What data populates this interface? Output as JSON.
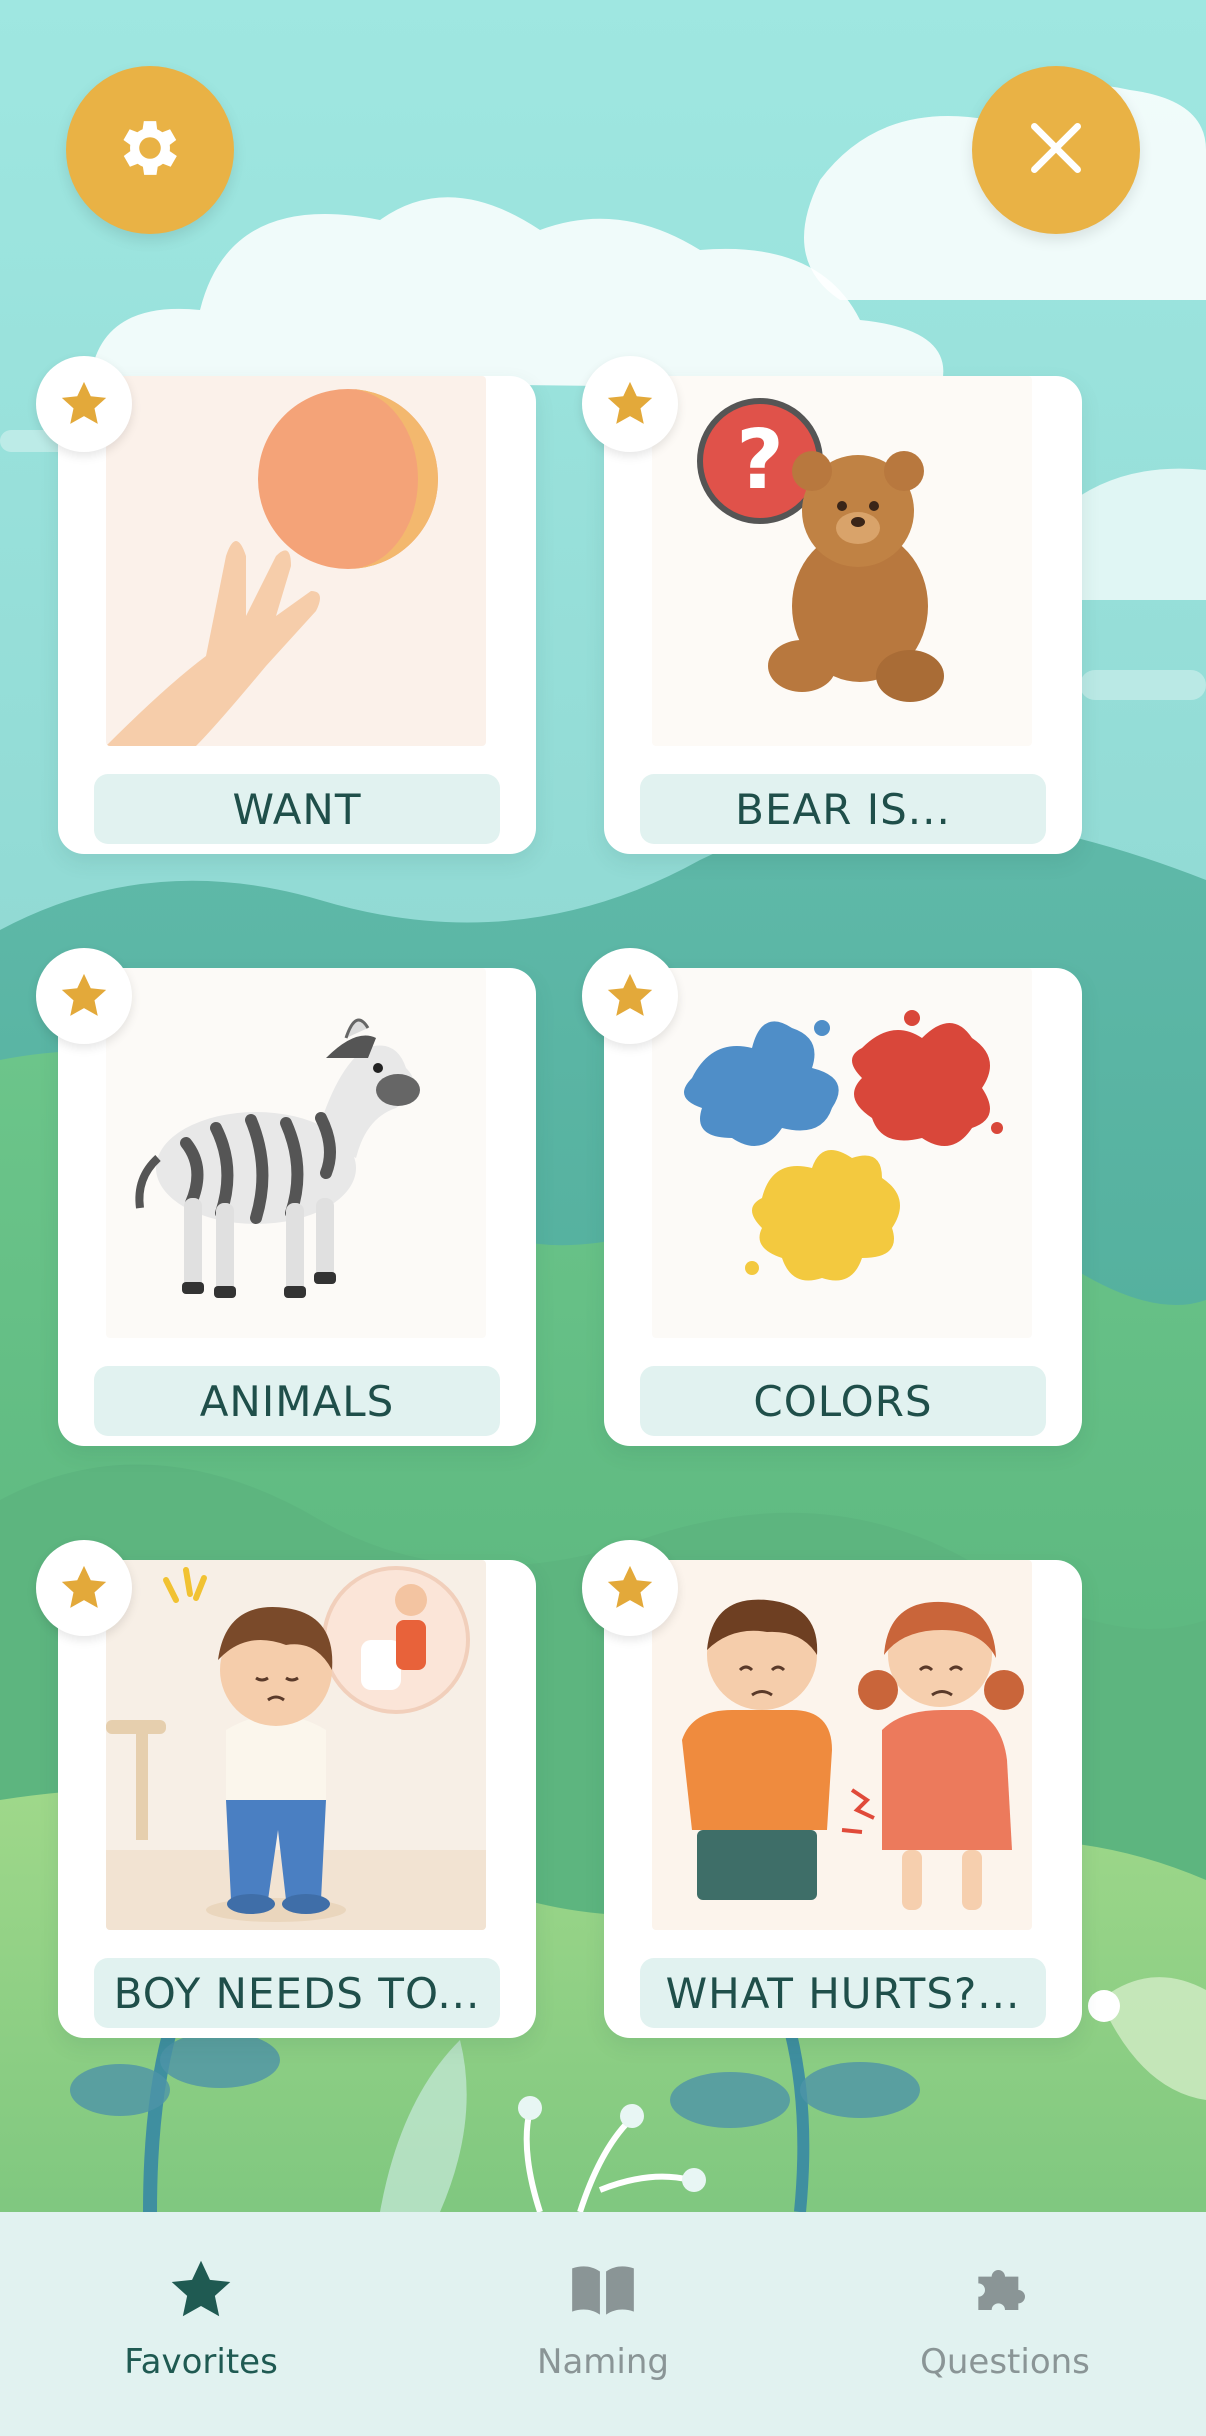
{
  "header": {
    "settings_icon": "gear-icon",
    "close_icon": "close-icon",
    "button_color": "#e9b245"
  },
  "cards": [
    {
      "label": "WANT",
      "art": "hand reaching for ball"
    },
    {
      "label": "BEAR IS...",
      "art": "teddy bear with question mark"
    },
    {
      "label": "ANIMALS",
      "art": "zebra"
    },
    {
      "label": "COLORS",
      "art": "paint splashes"
    },
    {
      "label": "BOY NEEDS TO...",
      "art": "boy needing toilet"
    },
    {
      "label": "WHAT HURTS?...",
      "art": "children in pain"
    }
  ],
  "tabs": [
    {
      "label": "Favorites",
      "icon": "star-icon",
      "active": true
    },
    {
      "label": "Naming",
      "icon": "book-icon",
      "active": false
    },
    {
      "label": "Questions",
      "icon": "puzzle-icon",
      "active": false
    }
  ],
  "colors": {
    "accent": "#e9b245",
    "label_text": "#1f4f4a",
    "tab_active": "#1f5a52",
    "tab_inactive": "#8a9596"
  }
}
